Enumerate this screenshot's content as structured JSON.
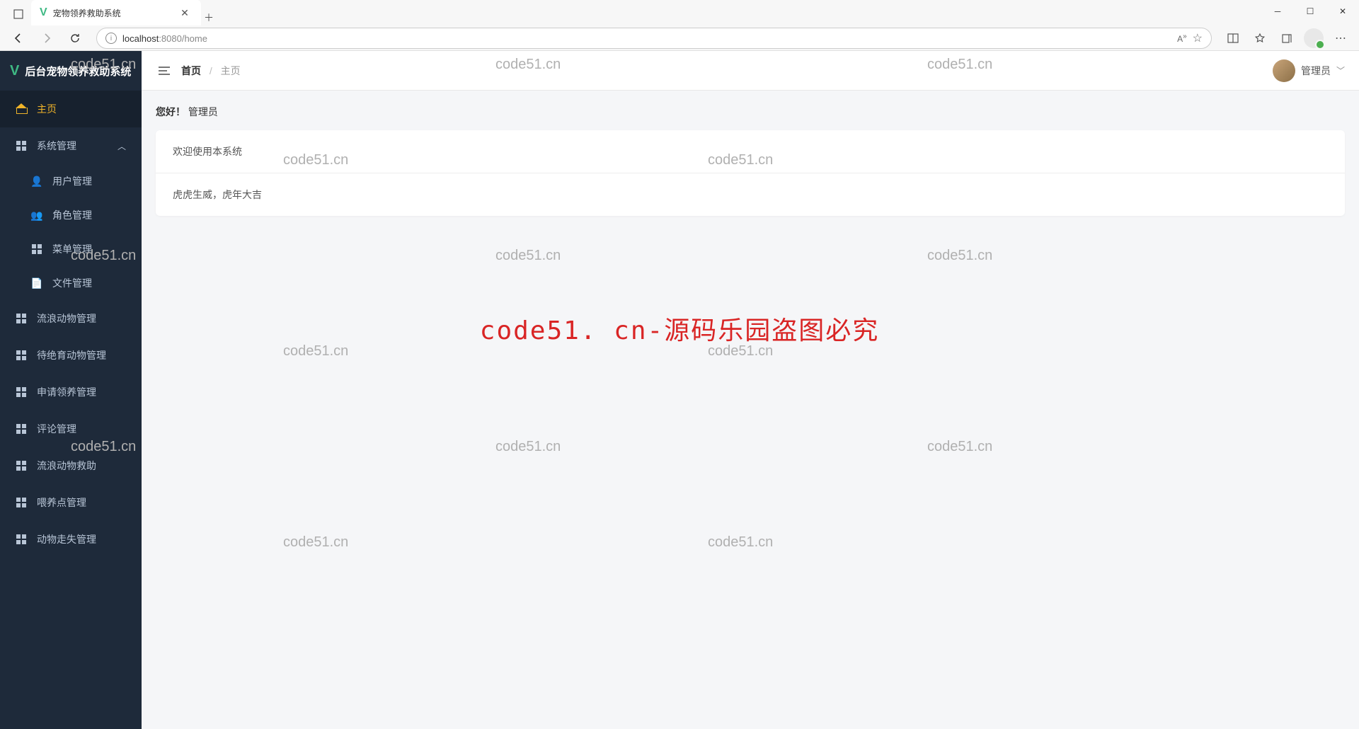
{
  "browser": {
    "tab_title": "宠物领养救助系统",
    "url_host": "localhost",
    "url_port_path": ":8080/home"
  },
  "sidebar": {
    "logo_text": "后台宠物领养救助系统",
    "items": [
      {
        "label": "主页",
        "active": true
      },
      {
        "label": "系统管理",
        "expand": true
      },
      {
        "label": "用户管理",
        "sub": true
      },
      {
        "label": "角色管理",
        "sub": true
      },
      {
        "label": "菜单管理",
        "sub": true
      },
      {
        "label": "文件管理",
        "sub": true
      },
      {
        "label": "流浪动物管理"
      },
      {
        "label": "待绝育动物管理"
      },
      {
        "label": "申请领养管理"
      },
      {
        "label": "评论管理"
      },
      {
        "label": "流浪动物救助"
      },
      {
        "label": "喂养点管理"
      },
      {
        "label": "动物走失管理"
      }
    ]
  },
  "topbar": {
    "crumb_root": "首页",
    "crumb_current": "主页",
    "user_label": "管理员"
  },
  "content": {
    "greeting_prefix": "您好！",
    "greeting_name": "管理员",
    "card_line1": "欢迎使用本系统",
    "card_line2": "虎虎生威，虎年大吉"
  },
  "watermark": {
    "text": "code51.cn",
    "center": "code51. cn-源码乐园盗图必究"
  }
}
